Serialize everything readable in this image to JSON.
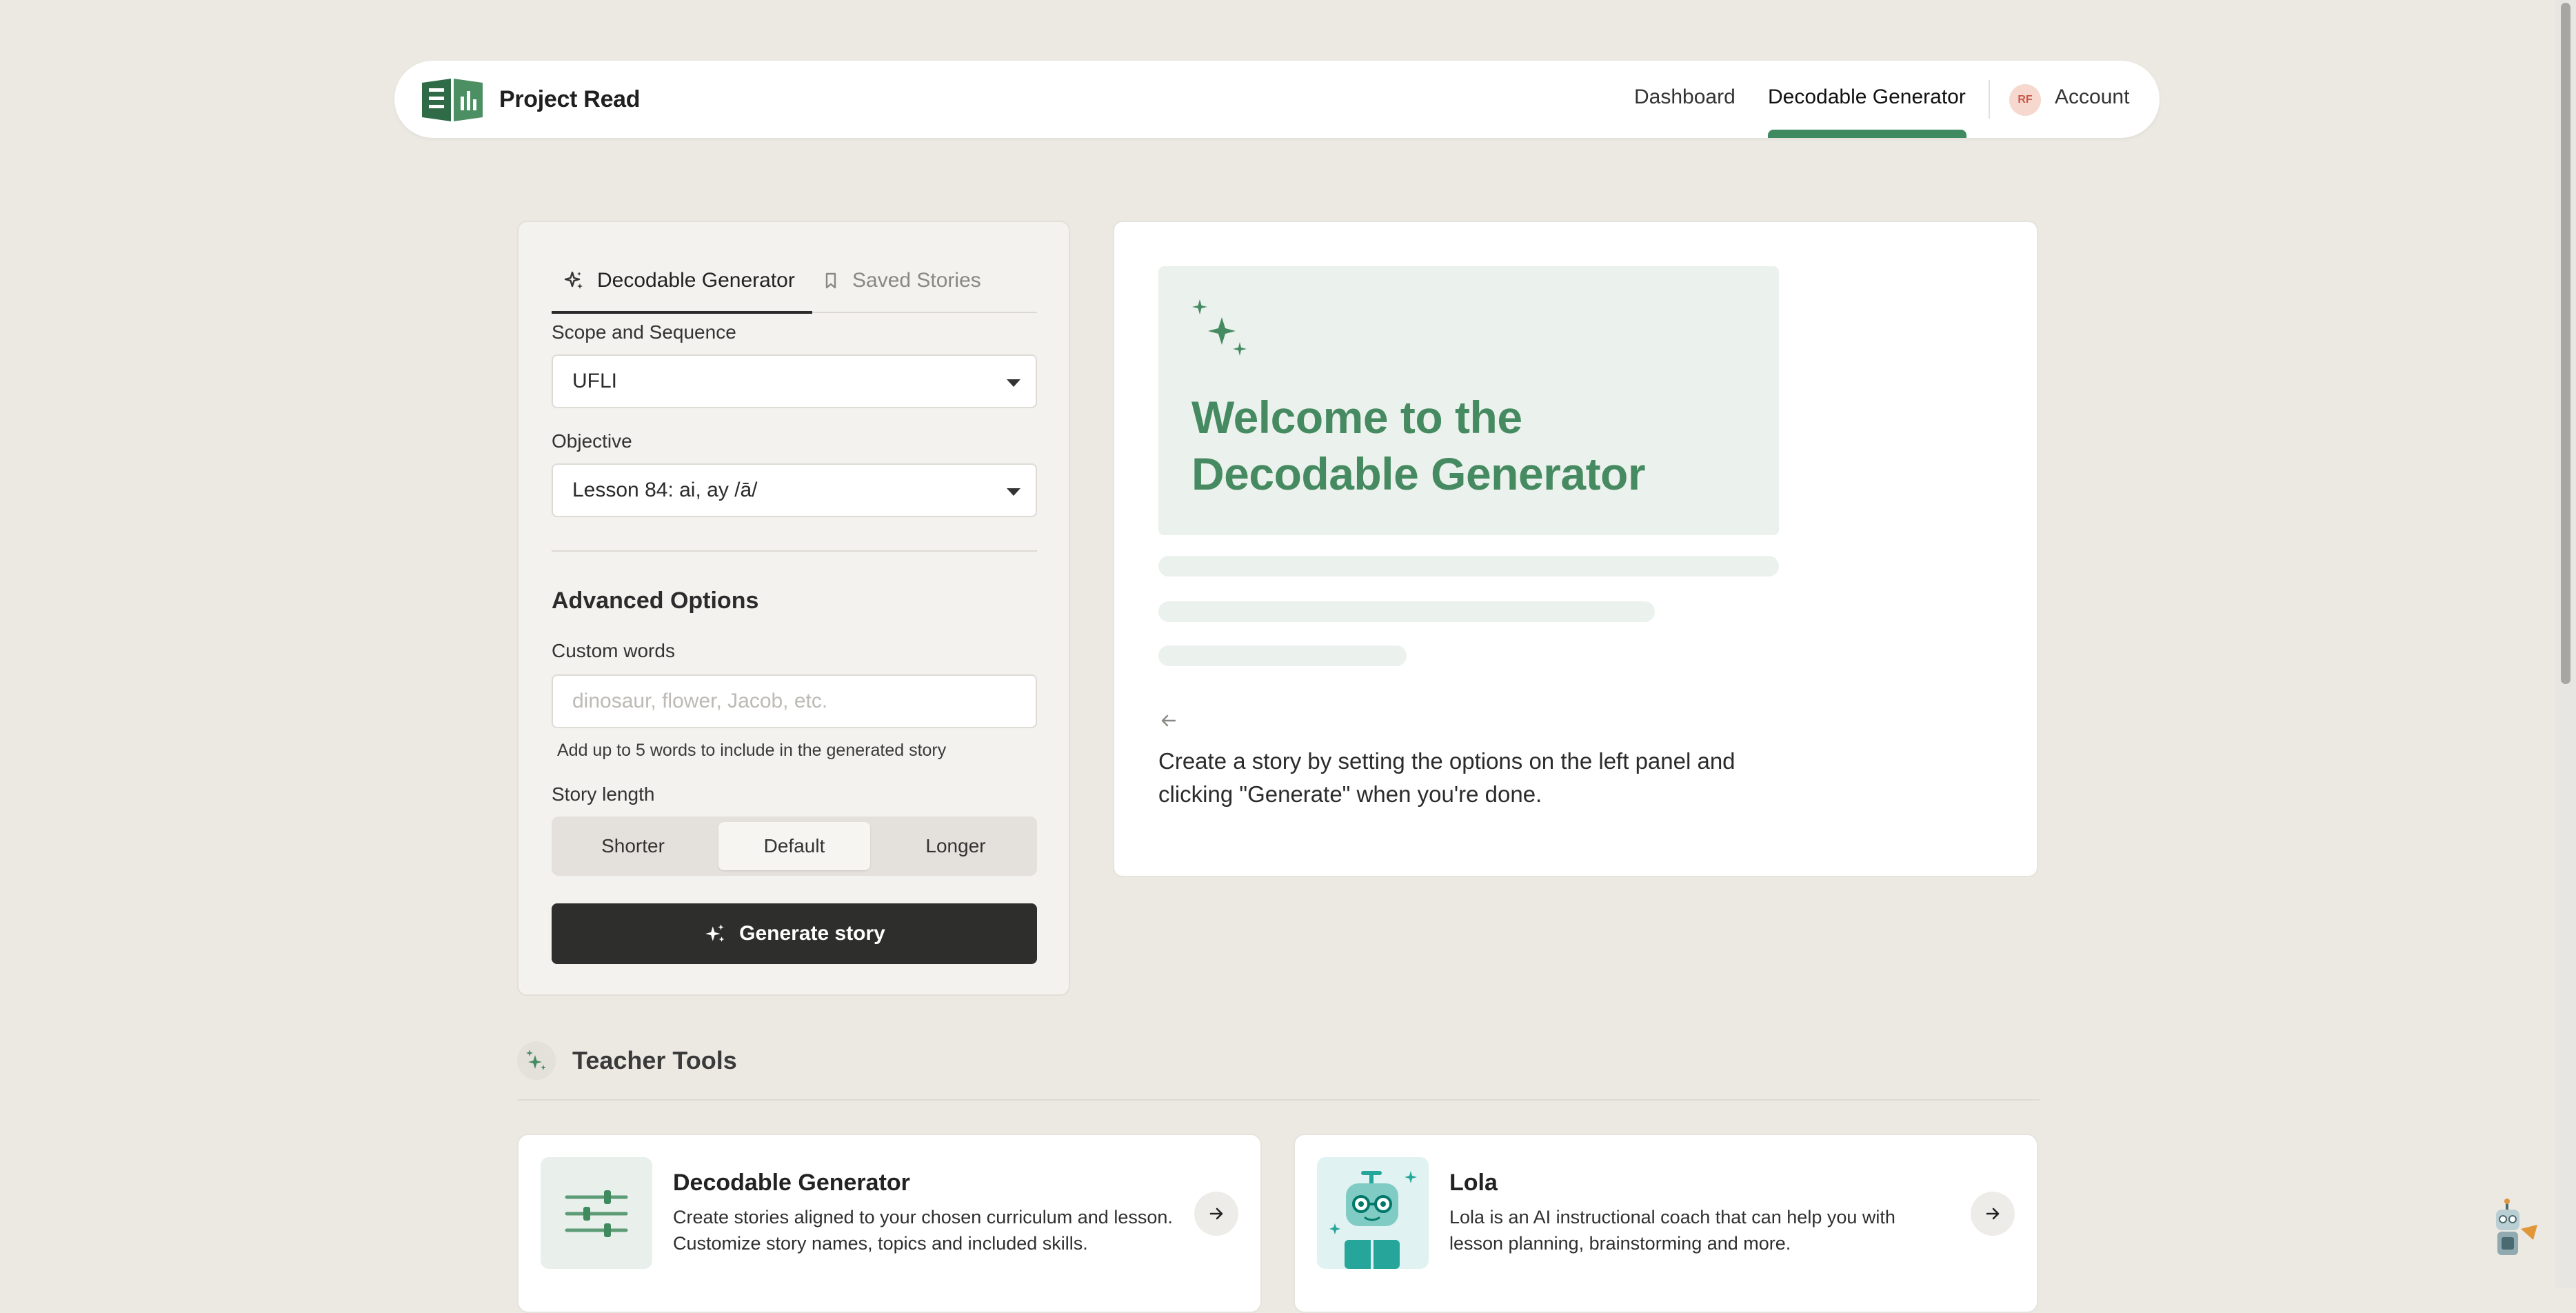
{
  "nav": {
    "brand": "Project Read",
    "links": [
      "Dashboard",
      "Decodable Generator"
    ],
    "account_initials": "RF",
    "account_label": "Account"
  },
  "panel": {
    "tabs": [
      {
        "label": "Decodable Generator",
        "icon": "sparkles-icon",
        "active": true
      },
      {
        "label": "Saved Stories",
        "icon": "bookmark-icon",
        "active": false
      }
    ],
    "scope": {
      "label": "Scope and Sequence",
      "value": "UFLI"
    },
    "objective": {
      "label": "Objective",
      "value": "Lesson 84: ai, ay /ā/"
    },
    "advanced_title": "Advanced Options",
    "custom_words": {
      "label": "Custom words",
      "placeholder": "dinosaur, flower, Jacob, etc.",
      "hint": "Add up to 5 words to include in the generated story"
    },
    "story_length": {
      "label": "Story length",
      "options": [
        "Shorter",
        "Default",
        "Longer"
      ],
      "selected": "Default"
    },
    "generate_label": "Generate story"
  },
  "welcome": {
    "title": "Welcome to the Decodable Generator",
    "description": "Create a story by setting the options on the left panel and clicking \"Generate\" when you're done."
  },
  "tools": {
    "title": "Teacher Tools",
    "items": [
      {
        "name": "Decodable Generator",
        "description": "Create stories aligned to your chosen curriculum and lesson. Customize story names, topics and included skills."
      },
      {
        "name": "Lola",
        "description": "Lola is an AI instructional coach that can help you with lesson planning, brainstorming and more."
      }
    ]
  },
  "colors": {
    "accent_green": "#468a61",
    "background": "#ece9e3",
    "button_dark": "#2e2e2d",
    "teal": "#26a69a"
  }
}
